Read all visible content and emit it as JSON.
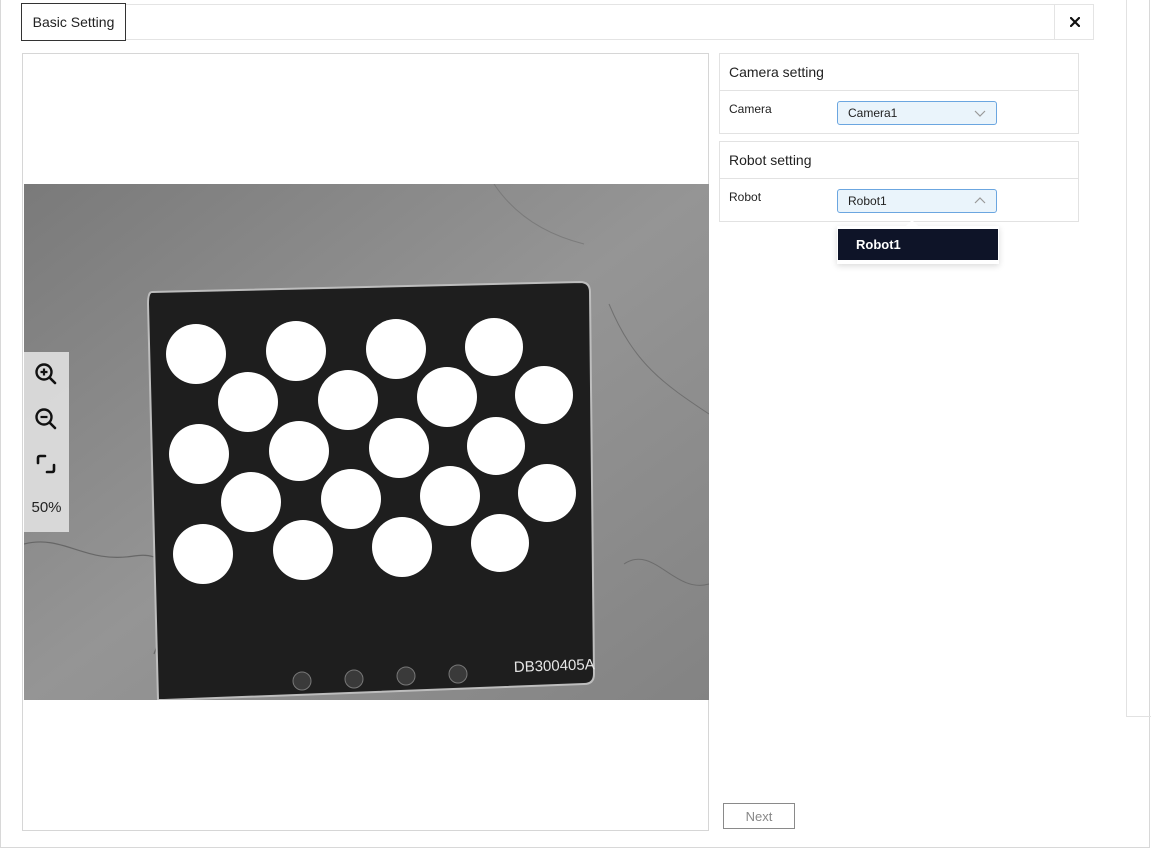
{
  "tabs": [
    {
      "label": "Basic Setting",
      "active": true
    }
  ],
  "viewer": {
    "zoom_label": "50%",
    "board_label": "DB300405A"
  },
  "camera_setting": {
    "title": "Camera setting",
    "field_label": "Camera",
    "selected": "Camera1"
  },
  "robot_setting": {
    "title": "Robot setting",
    "field_label": "Robot",
    "selected": "Robot1",
    "options": [
      "Robot1"
    ]
  },
  "footer": {
    "next_label": "Next"
  },
  "colors": {
    "select_border": "#6ba6e0",
    "select_bg": "#eaf4fb",
    "option_selected_bg": "#0e1428",
    "board": "#1e1e1e",
    "floor": "#8a8a8a"
  },
  "icons": [
    "close-icon",
    "zoom-in-icon",
    "zoom-out-icon",
    "fit-screen-icon",
    "chevron-down-icon",
    "chevron-up-icon"
  ]
}
